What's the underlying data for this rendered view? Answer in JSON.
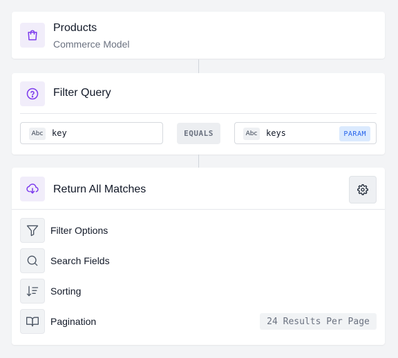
{
  "source": {
    "title": "Products",
    "subtitle": "Commerce Model"
  },
  "filter": {
    "title": "Filter Query",
    "left_type": "Abc",
    "left_value": "key",
    "operator": "EQUALS",
    "right_type": "Abc",
    "right_value": "keys",
    "right_badge": "PARAM"
  },
  "result": {
    "title": "Return All Matches",
    "options": [
      {
        "label": "Filter Options",
        "icon": "filter-icon"
      },
      {
        "label": "Search Fields",
        "icon": "search-icon"
      },
      {
        "label": "Sorting",
        "icon": "sort-icon"
      },
      {
        "label": "Pagination",
        "icon": "book-icon"
      }
    ],
    "pagination_value": "24 Results Per Page"
  },
  "colors": {
    "accent": "#7c3aed",
    "param": "#2563eb"
  }
}
